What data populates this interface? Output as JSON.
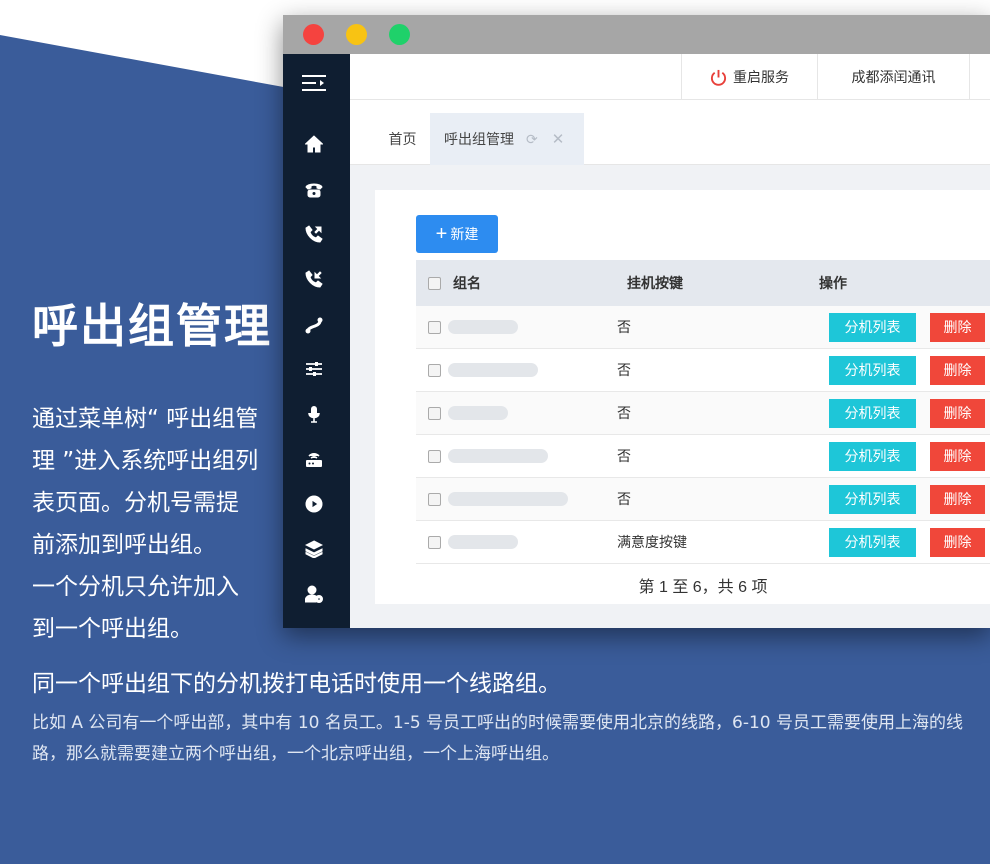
{
  "intro": {
    "title": "呼出组管理",
    "desc_lines": [
      "通过菜单树“ 呼出组管",
      "理 ”进入系统呼出组列",
      "表页面。分机号需提",
      "前添加到呼出组。",
      "一个分机只允许加入",
      "到一个呼出组。"
    ],
    "subhead": "同一个呼出组下的分机拨打电话时使用一个线路组。",
    "note": "比如 A 公司有一个呼出部，其中有 10 名员工。1-5 号员工呼出的时候需要使用北京的线路，6-10 号员工需要使用上海的线路，那么就需要建立两个呼出组，一个北京呼出组，一个上海呼出组。"
  },
  "colors": {
    "background_blue": "#3a5c9a",
    "sidebar": "#0f1e31",
    "primary": "#2d8cf0",
    "info": "#1ec6d8",
    "danger": "#f0473a"
  },
  "sidebar": {
    "icons": [
      "menu-toggle-icon",
      "home-icon",
      "telephone-icon",
      "phone-outgoing-icon",
      "phone-incoming-icon",
      "route-icon",
      "sliders-icon",
      "microphone-icon",
      "router-icon",
      "play-circle-icon",
      "layers-icon",
      "user-settings-icon"
    ]
  },
  "topbar": {
    "restart_label": "重启服务",
    "company_label": "成都添闰通讯"
  },
  "tabs": {
    "home_label": "首页",
    "active_label": "呼出组管理"
  },
  "toolbar": {
    "new_label": "新建"
  },
  "table": {
    "headers": {
      "name": "组名",
      "hangup_key": "挂机按键",
      "actions": "操作"
    },
    "rows": [
      {
        "name": "",
        "hangup_key": "否"
      },
      {
        "name": "",
        "hangup_key": "否"
      },
      {
        "name": "",
        "hangup_key": "否"
      },
      {
        "name": "",
        "hangup_key": "否"
      },
      {
        "name": "",
        "hangup_key": "否"
      },
      {
        "name": "",
        "hangup_key": "满意度按键"
      }
    ],
    "ext_list_label": "分机列表",
    "delete_label": "删除",
    "pagination": "第 1 至 6，共 6 项"
  }
}
